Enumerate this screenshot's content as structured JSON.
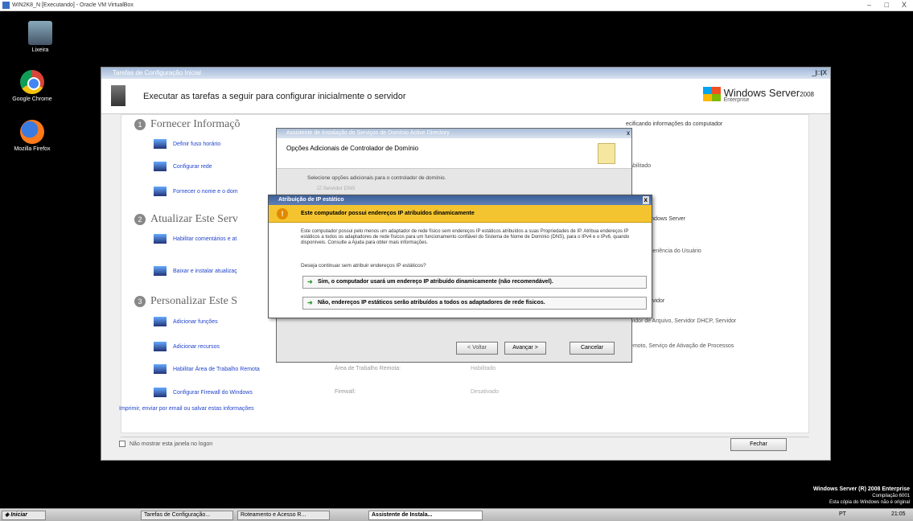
{
  "vbox": {
    "title": "WIN2K8_N [Executando] - Oracle VM VirtualBox",
    "min": "–",
    "max": "□",
    "close": "X"
  },
  "desktop": {
    "icons": [
      {
        "label": "Lixeira",
        "icon": "trash-icon"
      },
      {
        "label": "Google Chrome",
        "icon": "chrome-icon"
      },
      {
        "label": "Mozilla Firefox",
        "icon": "firefox-icon"
      }
    ]
  },
  "main_window": {
    "title": "Tarefas de Configuração Inicial",
    "controls": "_|□|X",
    "banner_title": "Executar as tarefas a seguir para configurar inicialmente o servidor",
    "logo": {
      "brand": "Windows Server",
      "version": "2008",
      "edition": "Enterprise"
    },
    "sections": [
      {
        "num": "1",
        "title": "Fornecer Informaçõ",
        "right_header": "ecificando informações do computador"
      },
      {
        "num": "2",
        "title": "Atualizar Este Serv",
        "right_header": "do seu Windows Server"
      },
      {
        "num": "3",
        "title": "Personalizar Este S",
        "right_header": "ando o servidor"
      }
    ],
    "links": [
      {
        "label": "Definir fuso horário"
      },
      {
        "label": "Configurar rede"
      },
      {
        "label": "Fornecer o nome e o dom"
      },
      {
        "label": "Habilitar comentários e at"
      },
      {
        "label": "Baixar e instalar atualizaç"
      },
      {
        "label": "Adicionar funções"
      },
      {
        "label": "Adicionar recursos"
      },
      {
        "label": "Habilitar Área de Trabalho Remota"
      },
      {
        "label": "Configurar Firewall do Windows"
      }
    ],
    "right_values": [
      "Habilitado",
      "nto da Experiência do Usuário",
      "ervidor de Arquivo, Servidor DHCP, Servidor",
      "Remoto, Serviço de Ativação de Processos"
    ],
    "rows": [
      {
        "key": "Área de Trabalho Remota:",
        "value": "Habilitado"
      },
      {
        "key": "Firewall:",
        "value": "Desativado"
      }
    ],
    "footer_link": "Imprimir, enviar por email ou salvar estas informações",
    "checkbox_label": "Não mostrar esta janela no logon",
    "close_button": "Fechar"
  },
  "wizard": {
    "title": "Assistente de Instalação do Serviços de Domínio Active Directory",
    "close": "x",
    "heading": "Opções Adicionais de Controlador de Domínio",
    "instruction": "Selecione opções adicionais para o controlador de domínio.",
    "dns_option": "Servidor DNS",
    "back": "< Voltar",
    "next": "Avançar >",
    "cancel": "Cancelar"
  },
  "dialog": {
    "title": "Atribuição de IP estático",
    "close": "x",
    "warning": "Este computador possui endereços IP atribuídos dinamicamente",
    "body": "Este computador possui pelo menos um adaptador de rede físico sem endereços IP estáticos atribuídos a suas Propriedades de IP. Atribua endereços IP estáticos a todos os adaptadores de rede físicos para um funcionamento confiável do Sistema de Nome de Domínio (DNS), para o IPv4 e o IPv6, quando disponíveis. Consulte a Ajuda para obter mais informações.",
    "question": "Deseja continuar sem atribuir endereços IP estáticos?",
    "option_yes": "Sim, o computador usará um endereço IP atribuído dinamicamente (não recomendável).",
    "option_no": "Não, endereços IP estáticos serão atribuídos a todos os adaptadores de rede físicos."
  },
  "watermark": {
    "line1": "Windows Server (R) 2008 Enterprise",
    "line2": "Compilação 6001",
    "line3": "Esta cópia do Windows não é original"
  },
  "taskbar": {
    "start": "Iniciar",
    "tasks": [
      "Tarefas de Configuração...",
      "Roteamento e Acesso R...",
      "Assistente de Instala..."
    ],
    "lang": "PT",
    "time": "21:05"
  }
}
